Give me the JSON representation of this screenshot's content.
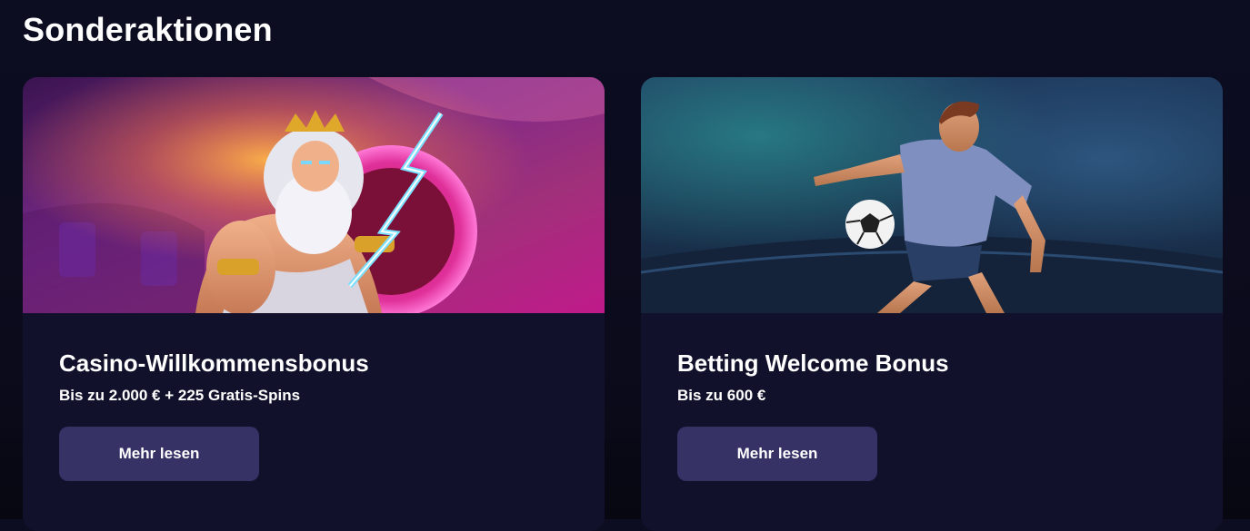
{
  "page": {
    "title": "Sonderaktionen"
  },
  "promotions": [
    {
      "id": "casino",
      "title": "Casino-Willkommensbonus",
      "subtitle": "Bis zu 2.000 € + 225 Gratis-Spins",
      "button_label": "Mehr lesen",
      "banner_subject": "zeus-with-lightning"
    },
    {
      "id": "betting",
      "title": "Betting Welcome Bonus",
      "subtitle": "Bis zu 600 €",
      "button_label": "Mehr lesen",
      "banner_subject": "football-player-kicking-ball"
    }
  ],
  "colors": {
    "background": "#0d0d22",
    "card": "#11112b",
    "button": "#363266",
    "text": "#ffffff"
  }
}
